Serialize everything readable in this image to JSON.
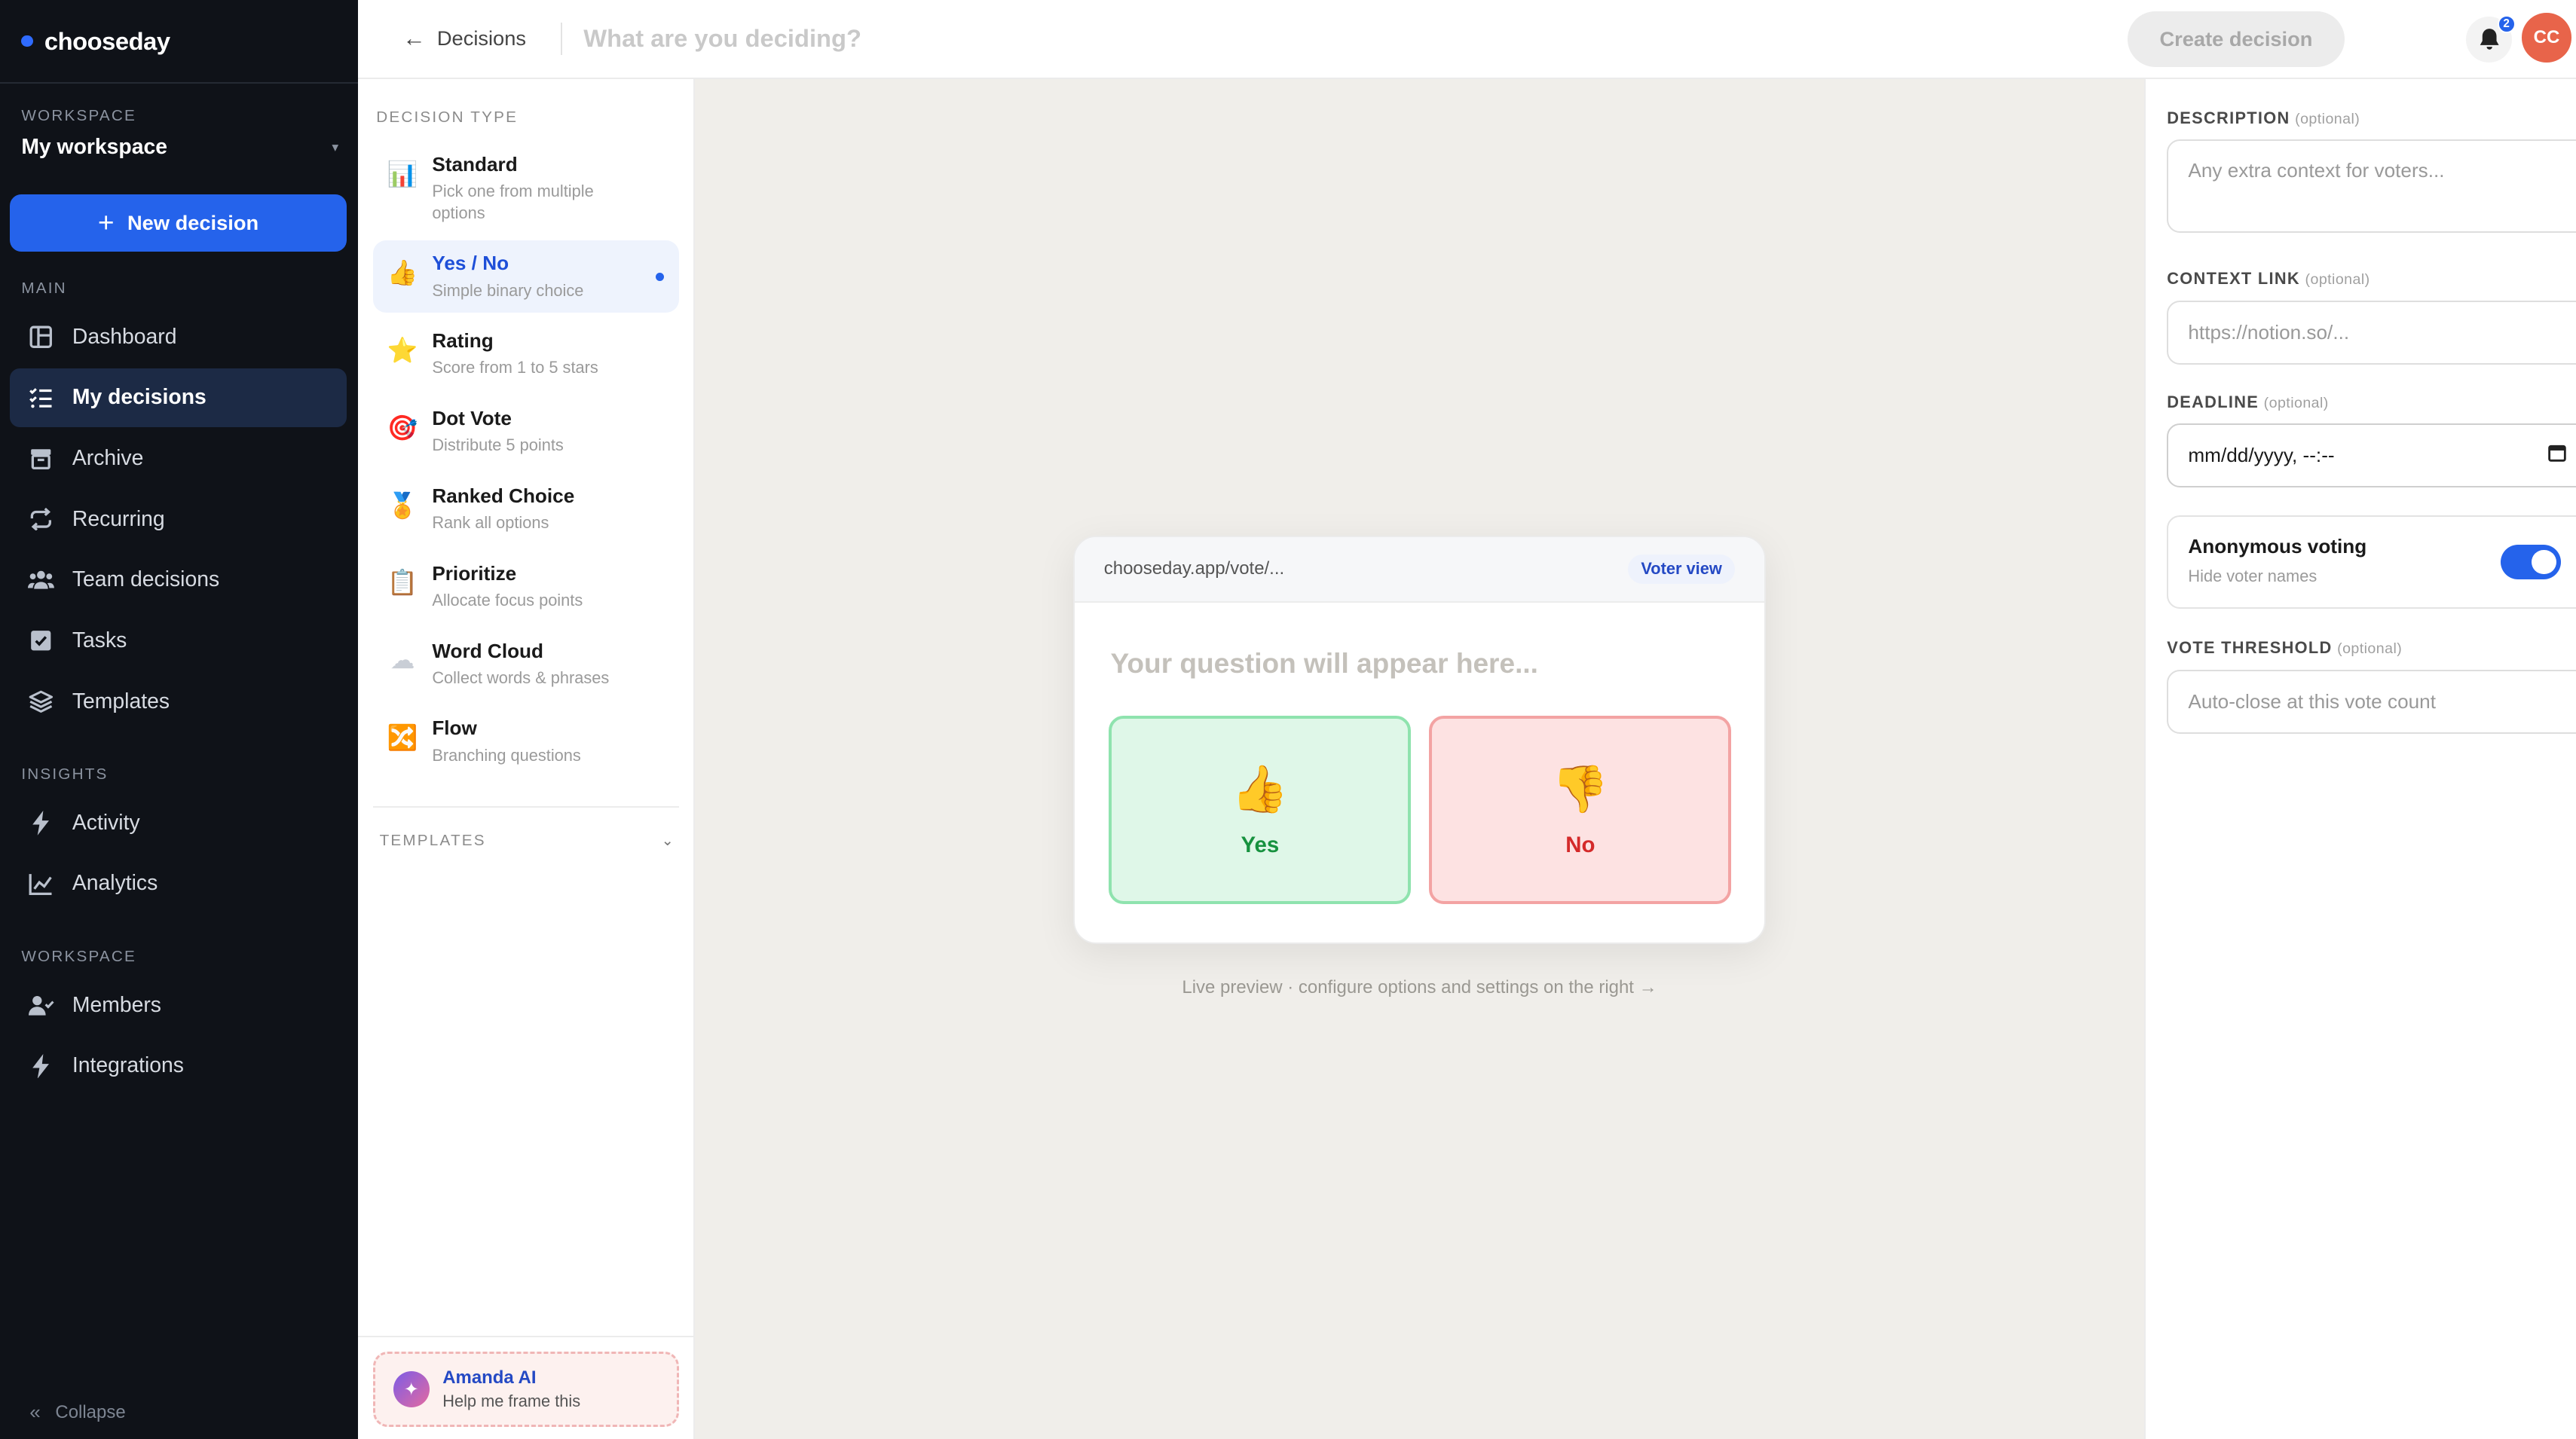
{
  "sidebar": {
    "brand": "chooseday",
    "workspace_label": "WORKSPACE",
    "workspace_name": "My workspace",
    "new_decision": "New decision",
    "sections": {
      "main": "MAIN",
      "insights": "INSIGHTS",
      "workspace": "WORKSPACE"
    },
    "main_items": [
      {
        "label": "Dashboard",
        "icon": "dashboard-icon"
      },
      {
        "label": "My decisions",
        "icon": "list-check-icon",
        "active": true
      },
      {
        "label": "Archive",
        "icon": "archive-icon"
      },
      {
        "label": "Recurring",
        "icon": "repeat-icon"
      },
      {
        "label": "Team decisions",
        "icon": "team-icon"
      },
      {
        "label": "Tasks",
        "icon": "checkbox-icon"
      },
      {
        "label": "Templates",
        "icon": "layers-icon"
      }
    ],
    "insights_items": [
      {
        "label": "Activity",
        "icon": "bolt-icon"
      },
      {
        "label": "Analytics",
        "icon": "chart-line-icon"
      }
    ],
    "workspace_items": [
      {
        "label": "Members",
        "icon": "user-check-icon"
      },
      {
        "label": "Integrations",
        "icon": "bolt-icon"
      }
    ],
    "collapse": "Collapse"
  },
  "topbar": {
    "back_label": "Decisions",
    "question_placeholder": "What are you deciding?",
    "create_button": "Create decision",
    "notification_count": "2",
    "avatar_initials": "CC"
  },
  "types_panel": {
    "label": "DECISION TYPE",
    "items": [
      {
        "title": "Standard",
        "sub": "Pick one from multiple options",
        "emoji": "📊"
      },
      {
        "title": "Yes / No",
        "sub": "Simple binary choice",
        "emoji": "👍",
        "active": true
      },
      {
        "title": "Rating",
        "sub": "Score from 1 to 5 stars",
        "emoji": "⭐"
      },
      {
        "title": "Dot Vote",
        "sub": "Distribute 5 points",
        "emoji": "🎯"
      },
      {
        "title": "Ranked Choice",
        "sub": "Rank all options",
        "emoji": "🏅"
      },
      {
        "title": "Prioritize",
        "sub": "Allocate focus points",
        "emoji": "📋"
      },
      {
        "title": "Word Cloud",
        "sub": "Collect words & phrases",
        "emoji": "☁"
      },
      {
        "title": "Flow",
        "sub": "Branching questions",
        "emoji": "🔀"
      }
    ],
    "templates_label": "TEMPLATES",
    "ai": {
      "title": "Amanda AI",
      "sub": "Help me frame this"
    }
  },
  "preview": {
    "url": "chooseday.app/vote/...",
    "voter_view": "Voter view",
    "question_placeholder": "Your question will appear here...",
    "yes_label": "Yes",
    "no_label": "No",
    "caption": "Live preview · configure options and settings on the right →"
  },
  "settings": {
    "optional": "(optional)",
    "description_label": "DESCRIPTION",
    "description_placeholder": "Any extra context for voters...",
    "context_label": "CONTEXT LINK",
    "context_placeholder": "https://notion.so/...",
    "deadline_label": "DEADLINE",
    "deadline_value": "mm/dd/yyyy, --:--",
    "anonymous_title": "Anonymous voting",
    "anonymous_sub": "Hide voter names",
    "anonymous_on": true,
    "threshold_label": "VOTE THRESHOLD",
    "threshold_placeholder": "Auto-close at this vote count"
  },
  "colors": {
    "accent": "#2563eb",
    "sidebar_bg": "#0f1218",
    "yes": "#17923f",
    "no": "#d42a2a",
    "avatar": "#e8644a"
  }
}
